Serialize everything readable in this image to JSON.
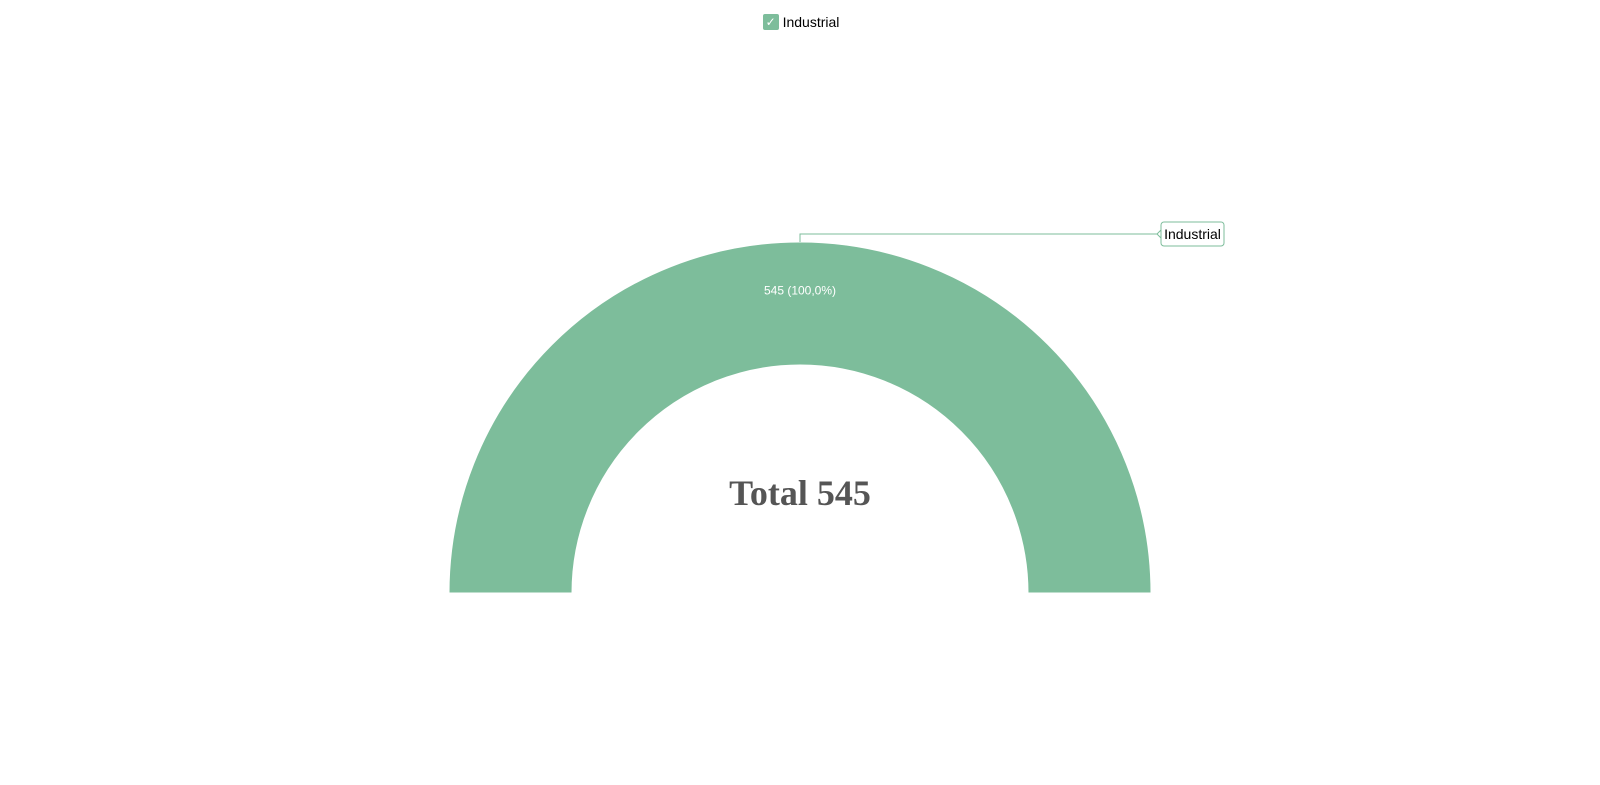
{
  "chart_data": {
    "type": "pie",
    "variant": "semi-donut",
    "categories": [
      "Industrial"
    ],
    "values": [
      545
    ],
    "slice_labels": [
      "545 (100,0%)"
    ],
    "callout_labels": [
      "Industrial"
    ],
    "colors": [
      "#7dbd9b"
    ],
    "center_text": "Total 545",
    "legend": {
      "placement": "top-center",
      "items": [
        {
          "label": "Industrial",
          "checked": true,
          "color": "#7dbd9b",
          "check_glyph": "✓"
        }
      ]
    }
  }
}
